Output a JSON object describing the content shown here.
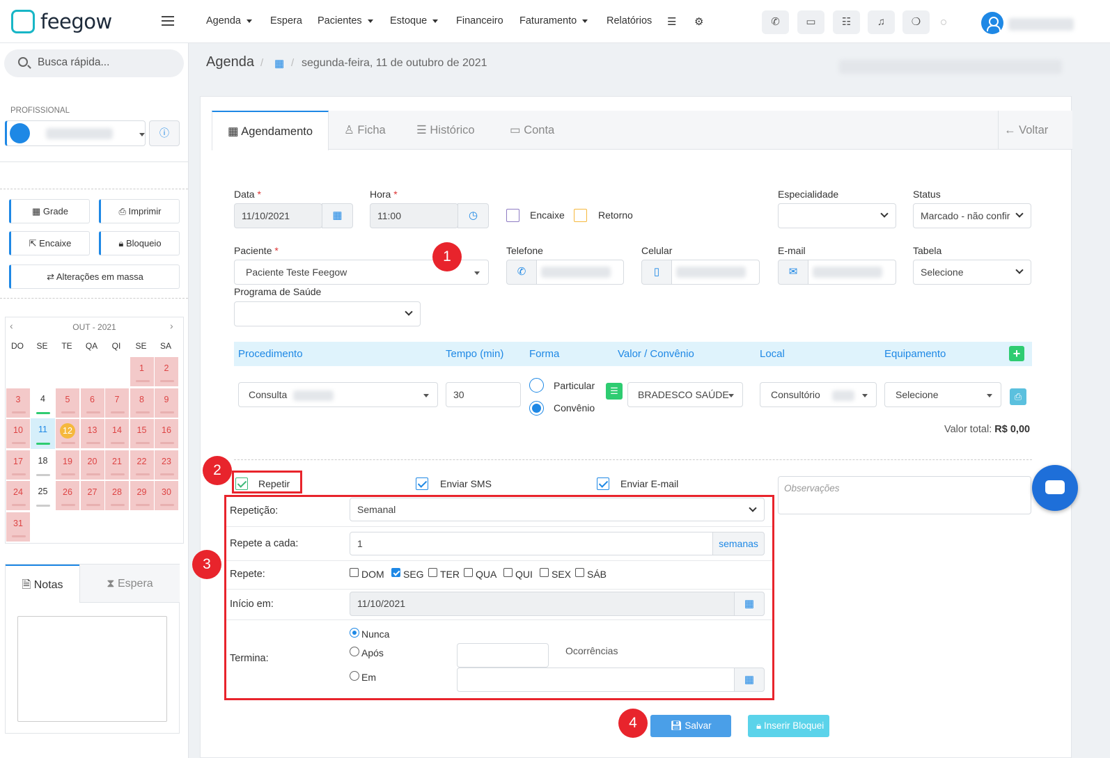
{
  "app": {
    "logo_text": "feegow"
  },
  "nav": [
    {
      "label": "Agenda",
      "dropdown": true
    },
    {
      "label": "Espera",
      "dropdown": false
    },
    {
      "label": "Pacientes",
      "dropdown": true
    },
    {
      "label": "Estoque",
      "dropdown": true
    },
    {
      "label": "Financeiro",
      "dropdown": false
    },
    {
      "label": "Faturamento",
      "dropdown": true
    },
    {
      "label": "Relatórios",
      "dropdown": false
    }
  ],
  "sidebar": {
    "search_placeholder": "Busca rápida...",
    "profissional_label": "PROFISSIONAL",
    "buttons": {
      "grade": "Grade",
      "imprimir": "Imprimir",
      "encaixe": "Encaixe",
      "bloqueio": "Bloqueio",
      "alteracoes": "Alterações em massa"
    },
    "calendar": {
      "month": "OUT - 2021",
      "weekdays": [
        "DO",
        "SE",
        "TE",
        "QA",
        "QI",
        "SE",
        "SA"
      ]
    },
    "notes_tabs": {
      "notas": "Notas",
      "espera": "Espera"
    }
  },
  "breadcrumb": {
    "title": "Agenda",
    "date": "segunda-feira, 11 de outubro de 2021"
  },
  "tabs": {
    "agendamento": "Agendamento",
    "ficha": "Ficha",
    "historico": "Histórico",
    "conta": "Conta",
    "voltar": "Voltar"
  },
  "form": {
    "data_label": "Data",
    "data_value": "11/10/2021",
    "hora_label": "Hora",
    "hora_value": "11:00",
    "encaixe_label": "Encaixe",
    "retorno_label": "Retorno",
    "especialidade_label": "Especialidade",
    "status_label": "Status",
    "status_value": "Marcado - não confir",
    "paciente_label": "Paciente",
    "paciente_value": "Paciente Teste Feegow",
    "telefone_label": "Telefone",
    "celular_label": "Celular",
    "email_label": "E-mail",
    "tabela_label": "Tabela",
    "tabela_value": "Selecione",
    "programa_label": "Programa de Saúde"
  },
  "procedures": {
    "headers": {
      "procedimento": "Procedimento",
      "tempo": "Tempo (min)",
      "forma": "Forma",
      "valor": "Valor / Convênio",
      "local": "Local",
      "equipamento": "Equipamento"
    },
    "row": {
      "procedimento": "Consulta",
      "tempo": "30",
      "particular": "Particular",
      "convenio": "Convênio",
      "convenio_value": "BRADESCO SAÚDE",
      "local": "Consultório",
      "equipamento": "Selecione"
    },
    "total_label": "Valor total:",
    "total_value": "R$ 0,00"
  },
  "options": {
    "repetir": "Repetir",
    "enviar_sms": "Enviar SMS",
    "enviar_email": "Enviar E-mail",
    "observacoes_placeholder": "Observações"
  },
  "repeat": {
    "repeticao_label": "Repetição:",
    "repeticao_value": "Semanal",
    "repete_cada_label": "Repete a cada:",
    "repete_cada_value": "1",
    "repete_cada_unit": "semanas",
    "repete_label": "Repete:",
    "days": [
      {
        "label": "DOM",
        "checked": false
      },
      {
        "label": "SEG",
        "checked": true
      },
      {
        "label": "TER",
        "checked": false
      },
      {
        "label": "QUA",
        "checked": false
      },
      {
        "label": "QUI",
        "checked": false
      },
      {
        "label": "SEX",
        "checked": false
      },
      {
        "label": "SÁB",
        "checked": false
      }
    ],
    "inicio_label": "Início em:",
    "inicio_value": "11/10/2021",
    "termina_label": "Termina:",
    "nunca": "Nunca",
    "apos": "Após",
    "em": "Em",
    "ocorrencias": "Ocorrências"
  },
  "actions": {
    "salvar": "Salvar",
    "inserir_bloqueio": "Inserir Bloquei"
  },
  "annotations": [
    "1",
    "2",
    "3",
    "4"
  ],
  "colors": {
    "primary": "#1e88e5",
    "annotation": "#e8242c",
    "calendar_busy": "#f3c9c9",
    "success": "#2ecc71",
    "info_button": "#5bc0de"
  }
}
